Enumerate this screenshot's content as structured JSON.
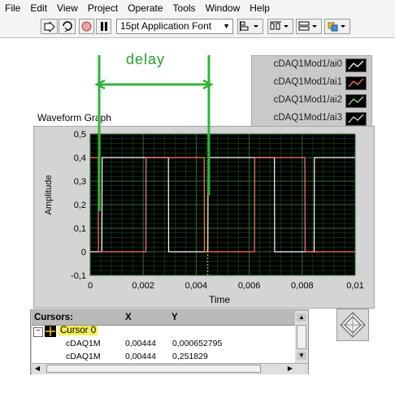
{
  "menu": [
    "File",
    "Edit",
    "View",
    "Project",
    "Operate",
    "Tools",
    "Window",
    "Help"
  ],
  "toolbar": {
    "font_selector": "15pt Application Font",
    "buttons": [
      "run-arrow-icon",
      "run-continuous-icon",
      "abort-icon",
      "pause-icon",
      "align-icon",
      "distribute-icon",
      "resize-icon",
      "reorder-icon"
    ]
  },
  "annotation": {
    "delay_label": "delay",
    "color": "#22a02c"
  },
  "graph": {
    "title": "Waveform Graph",
    "ylabel": "Amplitude",
    "xlabel": "Time",
    "plot_bg": "#000000",
    "grid_color": "#1f5a1f"
  },
  "legend": [
    {
      "name": "cDAQ1Mod1/ai0",
      "color": "#ffffff"
    },
    {
      "name": "cDAQ1Mod1/ai1",
      "color": "#ff7a6e"
    },
    {
      "name": "cDAQ1Mod1/ai2",
      "color": "#9adf8a"
    },
    {
      "name": "cDAQ1Mod1/ai3",
      "color": "#d9d9d9"
    }
  ],
  "chart_data": {
    "type": "line",
    "title": "Waveform Graph",
    "xlabel": "Time",
    "ylabel": "Amplitude",
    "xlim": [
      0,
      0.01
    ],
    "ylim": [
      -0.1,
      0.5
    ],
    "xticks": [
      "0",
      "0,002",
      "0,004",
      "0,006",
      "0,008",
      "0,01"
    ],
    "yticks": [
      "0,5",
      "0,4",
      "0,3",
      "0,2",
      "0,1",
      "0",
      "-0,1"
    ],
    "grid": true,
    "series": [
      {
        "name": "cDAQ1Mod1/ai0",
        "color": "#ffffff",
        "x": [
          0,
          0.00044,
          0.00045,
          0.00295,
          0.00296,
          0.00444,
          0.00445,
          0.00695,
          0.00696,
          0.00845,
          0.00846,
          0.01
        ],
        "y": [
          0,
          0,
          0.4,
          0.4,
          0,
          0,
          0.4,
          0.4,
          0,
          0,
          0.4,
          0.4
        ]
      },
      {
        "name": "cDAQ1Mod1/ai1",
        "color": "#ff7a6e",
        "x": [
          0,
          0.0003,
          0.00031,
          0.0021,
          0.00211,
          0.0043,
          0.00431,
          0.0062,
          0.00621,
          0.0081,
          0.00811,
          0.01
        ],
        "y": [
          0.4,
          0.4,
          0,
          0,
          0.4,
          0.4,
          0,
          0,
          0.4,
          0.4,
          0,
          0
        ]
      }
    ]
  },
  "cursors": {
    "header": [
      "Cursors:",
      "X",
      "Y"
    ],
    "name": "Cursor 0",
    "rows": [
      {
        "channel": "cDAQ1M",
        "x": "0,00444",
        "y": "0,000652795"
      },
      {
        "channel": "cDAQ1M",
        "x": "0,00444",
        "y": "0,251829"
      }
    ]
  }
}
